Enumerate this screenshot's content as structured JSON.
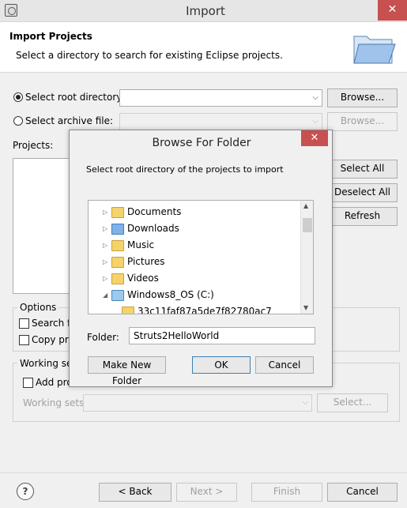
{
  "window": {
    "title": "Import",
    "close_glyph": "✕"
  },
  "banner": {
    "title": "Import Projects",
    "description": "Select a directory to search for existing Eclipse projects."
  },
  "source": {
    "root_label": "Select root directory:",
    "root_value": "",
    "archive_label": "Select archive file:",
    "archive_value": "",
    "browse_label": "Browse...",
    "browse_archive_label": "Browse..."
  },
  "projects": {
    "label": "Projects:",
    "select_all": "Select All",
    "deselect_all": "Deselect All",
    "refresh": "Refresh"
  },
  "options": {
    "title": "Options",
    "search_label": "Search fo",
    "copy_label": "Copy pro"
  },
  "working_sets": {
    "title": "Working set",
    "add_label": "Add pro",
    "sets_label": "Working sets:",
    "select_label": "Select..."
  },
  "footer": {
    "back": "< Back",
    "next": "Next >",
    "finish": "Finish",
    "cancel": "Cancel"
  },
  "dialog": {
    "title": "Browse For Folder",
    "close_glyph": "✕",
    "instruction": "Select root directory of the projects to import",
    "tree": [
      {
        "label": "Documents",
        "icon": "folder-icon",
        "expander": "▷"
      },
      {
        "label": "Downloads",
        "icon": "folder-download-icon",
        "expander": "▷"
      },
      {
        "label": "Music",
        "icon": "folder-music-icon",
        "expander": "▷"
      },
      {
        "label": "Pictures",
        "icon": "folder-pictures-icon",
        "expander": "▷"
      },
      {
        "label": "Videos",
        "icon": "folder-videos-icon",
        "expander": "▷"
      },
      {
        "label": "Windows8_OS (C:)",
        "icon": "drive-icon",
        "expander": "◢"
      },
      {
        "label": "33c11faf87a5de7f82780ac7",
        "icon": "folder-icon",
        "expander": ""
      }
    ],
    "folder_label": "Folder:",
    "folder_value": "Struts2HelloWorld",
    "make_new_folder": "Make New Folder",
    "ok": "OK",
    "cancel": "Cancel"
  }
}
